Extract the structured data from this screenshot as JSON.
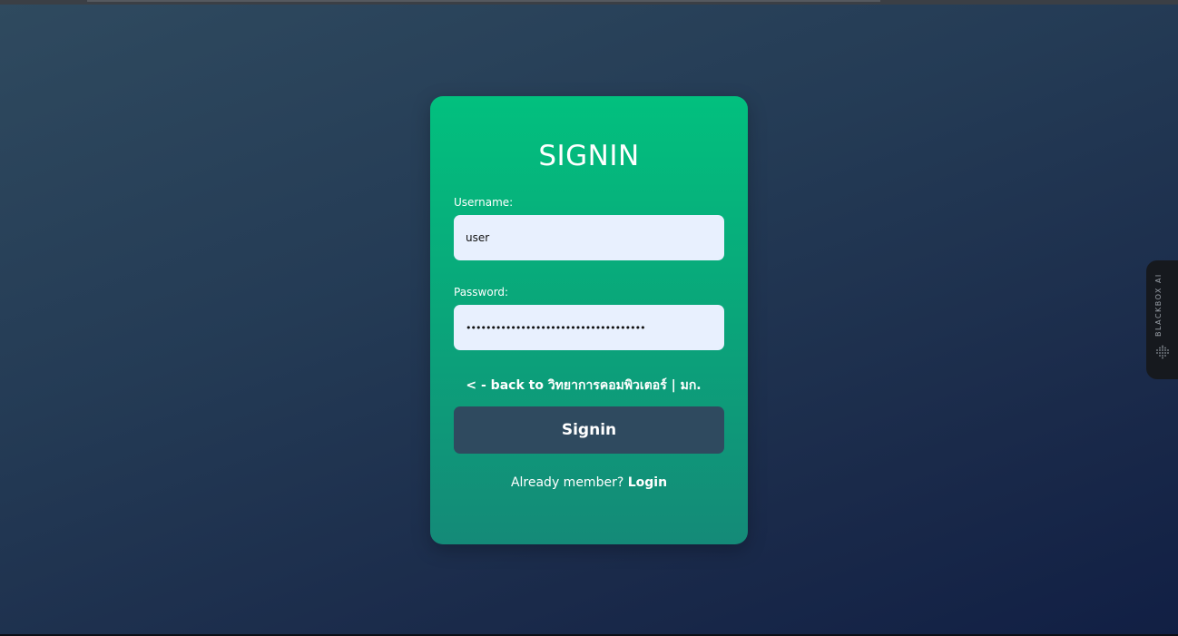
{
  "form": {
    "title": "SIGNIN",
    "username_label": "Username:",
    "username_value": "user",
    "password_label": "Password:",
    "password_value": "••••••••••••••••••••••••••••••••••••",
    "back_link": "< - back to วิทยาการคอมพิวเตอร์ | มก.",
    "submit_label": "Signin",
    "member_text": "Already member?",
    "login_link": "Login"
  },
  "extension": {
    "label": "BLACKBOX AI",
    "icon": "blackbox-logo-icon"
  },
  "colors": {
    "background_start": "#2f4a5f",
    "background_end": "#111f44",
    "card_top": "#02c07e",
    "card_bottom": "#148a78",
    "input_bg": "#e8f0fe",
    "button_bg": "#2f4a5f"
  }
}
